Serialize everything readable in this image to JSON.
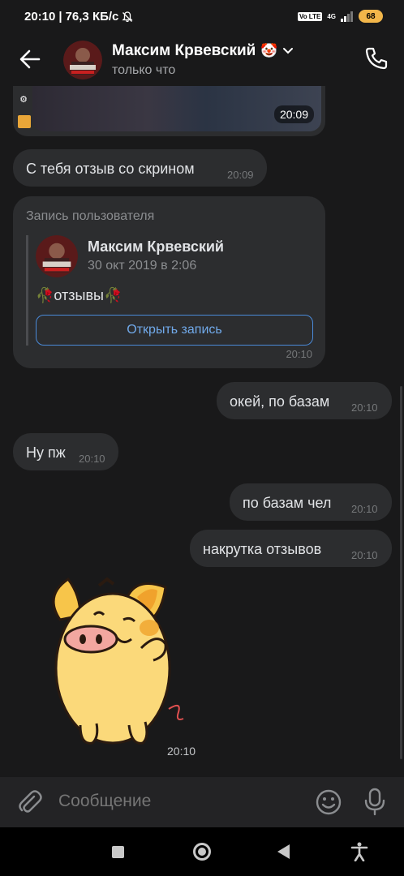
{
  "status_bar": {
    "time": "20:10",
    "net_speed": "76,3 КБ/с",
    "volte": "Vo LTE",
    "network": "4G",
    "battery": "68"
  },
  "header": {
    "contact_name": "Максим Крвевский",
    "contact_emoji": "🤡",
    "status": "только что"
  },
  "messages": {
    "image_time": "20:09",
    "m1_text": "С тебя отзыв со скрином",
    "m1_time": "20:09",
    "repost": {
      "header": "Запись пользователя",
      "author": "Максим Крвевский",
      "date": "30 окт 2019 в 2:06",
      "text": "🥀отзывы🥀",
      "button": "Открыть запись",
      "time": "20:10"
    },
    "m2_text": "окей, по базам",
    "m2_time": "20:10",
    "m3_text": "Ну пж",
    "m3_time": "20:10",
    "m4_text": "по базам чел",
    "m4_time": "20:10",
    "m5_text": "накрутка отзывов",
    "m5_time": "20:10",
    "sticker_time": "20:10"
  },
  "composer": {
    "placeholder": "Сообщение"
  },
  "icons": {
    "back": "arrow-left-icon",
    "call": "phone-icon",
    "attach": "paperclip-icon",
    "emoji": "smiley-icon",
    "voice": "microphone-icon"
  },
  "colors": {
    "background": "#19191a",
    "bubble": "#2c2d2f",
    "accent": "#71aaeb",
    "battery": "#f2b64a"
  }
}
